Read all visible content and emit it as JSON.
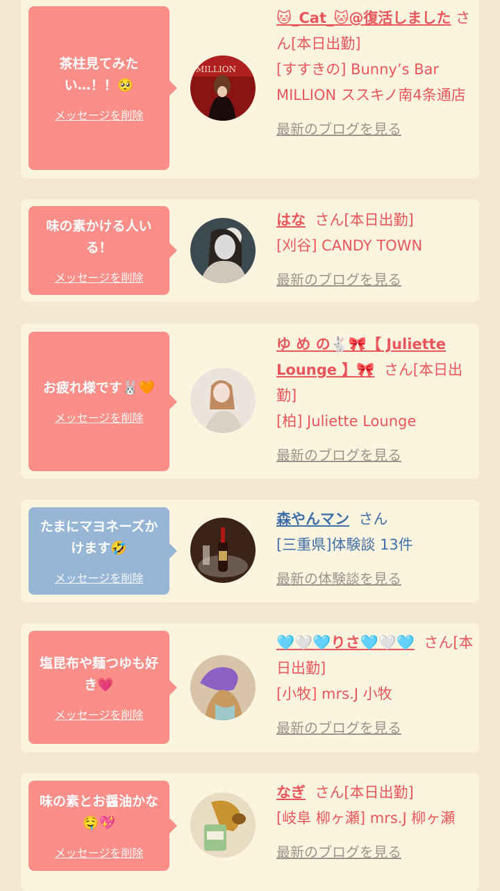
{
  "cards": [
    {
      "message_text": "茶柱見てみたい…！！🥺",
      "delete_label": "メッセージを削除",
      "name": "🐱_Cat_🐱@復活しました",
      "suffix": "さん[本日出勤]",
      "shop": "[すすきの] Bunny’s Bar MILLION ススキノ南4条通店",
      "link": "最新のブログを見る",
      "avatar_icon": "woman-in-red-room-photo",
      "bubble_color": "#fb8e88"
    },
    {
      "message_text": "味の素かける人いる！",
      "delete_label": "メッセージを削除",
      "name": "はな",
      "suffix": "さん[本日出勤]",
      "shop": "[刈谷] CANDY TOWN",
      "link": "最新のブログを見る",
      "avatar_icon": "woman-selfie-photo",
      "bubble_color": "#fb8e88"
    },
    {
      "message_text": "お疲れ様です🐰🧡",
      "delete_label": "メッセージを削除",
      "name": "ゆ め の🐇🎀【 Juliette Lounge 】🎀",
      "suffix": "さん[本日出勤]",
      "shop": "[柏] Juliette Lounge",
      "link": "最新のブログを見る",
      "avatar_icon": "woman-portrait-photo",
      "bubble_color": "#fb8e88"
    },
    {
      "message_text": "たまにマヨネーズかけます🤣",
      "delete_label": "メッセージを削除",
      "name": "森やんマン",
      "suffix": "さん",
      "shop": "[三重県]体験談 13件",
      "link": "最新の体験談を見る",
      "avatar_icon": "champagne-bottle-photo",
      "bubble_color": "#97b6d6"
    },
    {
      "message_text": "塩昆布や麺つゆも好き💗",
      "delete_label": "メッセージを削除",
      "name": "🩵🤍🩵りさ🩵🤍🩵",
      "suffix": "さん[本日出勤]",
      "shop": "[小牧] mrs.J 小牧",
      "link": "最新のブログを見る",
      "avatar_icon": "woman-hidden-face-photo",
      "bubble_color": "#fb8e88"
    },
    {
      "message_text": "味の素とお醤油かな🤤💖",
      "delete_label": "メッセージを削除",
      "name": "なぎ",
      "suffix": "さん[本日出勤]",
      "shop": "[岐阜 柳ヶ瀬] mrs.J 柳ヶ瀬",
      "link": "最新のブログを見る",
      "avatar_icon": "dog-illustration",
      "bubble_color": "#fb8e88"
    }
  ]
}
